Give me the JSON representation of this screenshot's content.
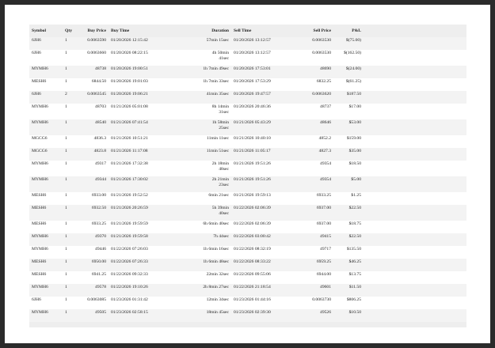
{
  "columns": [
    "Symbol",
    "Qty",
    "Buy Price",
    "Buy Time",
    "Duration",
    "Sell Time",
    "Sell Price",
    "P&L"
  ],
  "rows": [
    {
      "symbol": "6JH6",
      "qty": "1",
      "buy_price": "0.0063590",
      "buy_time": "01/20/2026 12:15:42",
      "duration": [
        "57min 15sec"
      ],
      "sell_time": "01/20/2026 13:12:57",
      "sell_price": "0.0063530",
      "pnl": "$(75.00)"
    },
    {
      "symbol": "6JH6",
      "qty": "1",
      "buy_price": "0.0063660",
      "buy_time": "01/20/2026 08:22:15",
      "duration": [
        "4h 50min",
        "41sec"
      ],
      "sell_time": "01/20/2026 13:12:57",
      "sell_price": "0.0063530",
      "pnl": "$(162.50)"
    },
    {
      "symbol": "MYMH6",
      "qty": "1",
      "buy_price": "48738",
      "buy_time": "01/20/2026 19:00:51",
      "duration": [
        "1h 7min 49sec"
      ],
      "sell_time": "01/20/2026 17:53:01",
      "sell_price": "48690",
      "pnl": "$(24.00)"
    },
    {
      "symbol": "MESH6",
      "qty": "1",
      "buy_price": "6844.50",
      "buy_time": "01/20/2026 19:01:03",
      "duration": [
        "1h 7min 33sec"
      ],
      "sell_time": "01/20/2026 17:53:29",
      "sell_price": "6832.25",
      "pnl": "$(61.25)"
    },
    {
      "symbol": "6JH6",
      "qty": "2",
      "buy_price": "0.0063545",
      "buy_time": "01/20/2026 19:06:21",
      "duration": [
        "41min 35sec"
      ],
      "sell_time": "01/20/2026 19:47:57",
      "sell_price": "0.0063620",
      "pnl": "$187.50"
    },
    {
      "symbol": "MYMH6",
      "qty": "1",
      "buy_price": "48703",
      "buy_time": "01/21/2026 05:01:08",
      "duration": [
        "8h 14min",
        "31sec"
      ],
      "sell_time": "01/20/2026 20:46:36",
      "sell_price": "48737",
      "pnl": "$17.00"
    },
    {
      "symbol": "MYMH6",
      "qty": "1",
      "buy_price": "48540",
      "buy_time": "01/21/2026 07:41:54",
      "duration": [
        "1h 58min",
        "25sec"
      ],
      "sell_time": "01/21/2026 05:43:29",
      "sell_price": "48646",
      "pnl": "$53.00"
    },
    {
      "symbol": "MGCG6",
      "qty": "1",
      "buy_price": "4836.3",
      "buy_time": "01/21/2026 10:51:21",
      "duration": [
        "11min 11sec"
      ],
      "sell_time": "01/21/2026 10:40:10",
      "sell_price": "4852.2",
      "pnl": "$159.00"
    },
    {
      "symbol": "MGCG6",
      "qty": "1",
      "buy_price": "4823.8",
      "buy_time": "01/21/2026 11:17:08",
      "duration": [
        "11min 51sec"
      ],
      "sell_time": "01/21/2026 11:05:17",
      "sell_price": "4827.3",
      "pnl": "$35.00"
    },
    {
      "symbol": "MYMH6",
      "qty": "1",
      "buy_price": "49317",
      "buy_time": "01/21/2026 17:32:38",
      "duration": [
        "2h 18min",
        "48sec"
      ],
      "sell_time": "01/21/2026 19:51:26",
      "sell_price": "49354",
      "pnl": "$18.50"
    },
    {
      "symbol": "MYMH6",
      "qty": "1",
      "buy_price": "49344",
      "buy_time": "01/21/2026 17:30:02",
      "duration": [
        "2h 21min",
        "23sec"
      ],
      "sell_time": "01/21/2026 19:51:26",
      "sell_price": "49354",
      "pnl": "$5.00"
    },
    {
      "symbol": "MESH6",
      "qty": "1",
      "buy_price": "6933.00",
      "buy_time": "01/21/2026 19:52:52",
      "duration": [
        "6min 21sec"
      ],
      "sell_time": "01/21/2026 19:59:13",
      "sell_price": "6933.25",
      "pnl": "$1.25"
    },
    {
      "symbol": "MESH6",
      "qty": "1",
      "buy_price": "6932.50",
      "buy_time": "01/21/2026 20:26:59",
      "duration": [
        "5h 39min",
        "40sec"
      ],
      "sell_time": "01/22/2026 02:06:39",
      "sell_price": "6937.00",
      "pnl": "$22.50"
    },
    {
      "symbol": "MESH6",
      "qty": "1",
      "buy_price": "6933.25",
      "buy_time": "01/21/2026 19:59:59",
      "duration": [
        "6h 6min 40sec"
      ],
      "sell_time": "01/22/2026 02:06:39",
      "sell_price": "6937.00",
      "pnl": "$18.75"
    },
    {
      "symbol": "MYMH6",
      "qty": "1",
      "buy_price": "49370",
      "buy_time": "01/21/2026 19:59:58",
      "duration": [
        "7h 44sec"
      ],
      "sell_time": "01/22/2026 03:00:42",
      "sell_price": "49415",
      "pnl": "$22.50"
    },
    {
      "symbol": "MYMH6",
      "qty": "1",
      "buy_price": "49446",
      "buy_time": "01/22/2026 07:26:03",
      "duration": [
        "1h 6min 16sec"
      ],
      "sell_time": "01/22/2026 08:32:19",
      "sell_price": "49717",
      "pnl": "$135.50"
    },
    {
      "symbol": "MESH6",
      "qty": "1",
      "buy_price": "6950.00",
      "buy_time": "01/22/2026 07:26:33",
      "duration": [
        "1h 6min 48sec"
      ],
      "sell_time": "01/22/2026 08:33:22",
      "sell_price": "6959.25",
      "pnl": "$46.25"
    },
    {
      "symbol": "MESH6",
      "qty": "1",
      "buy_price": "6941.25",
      "buy_time": "01/22/2026 09:32:33",
      "duration": [
        "22min 32sec"
      ],
      "sell_time": "01/22/2026 09:55:06",
      "sell_price": "6944.00",
      "pnl": "$13.75"
    },
    {
      "symbol": "MYMH6",
      "qty": "1",
      "buy_price": "49578",
      "buy_time": "01/22/2026 19:10:26",
      "duration": [
        "2h 8min 27sec"
      ],
      "sell_time": "01/22/2026 21:18:54",
      "sell_price": "49601",
      "pnl": "$11.50"
    },
    {
      "symbol": "6JH6",
      "qty": "1",
      "buy_price": "0.0063085",
      "buy_time": "01/23/2026 01:31:42",
      "duration": [
        "12min 34sec"
      ],
      "sell_time": "01/23/2026 01:44:16",
      "sell_price": "0.0063730",
      "pnl": "$806.25"
    },
    {
      "symbol": "MYMH6",
      "qty": "1",
      "buy_price": "49505",
      "buy_time": "01/23/2026 02:58:15",
      "duration": [
        "18min 45sec"
      ],
      "sell_time": "01/23/2026 02:39:30",
      "sell_price": "49526",
      "pnl": "$10.50"
    }
  ]
}
